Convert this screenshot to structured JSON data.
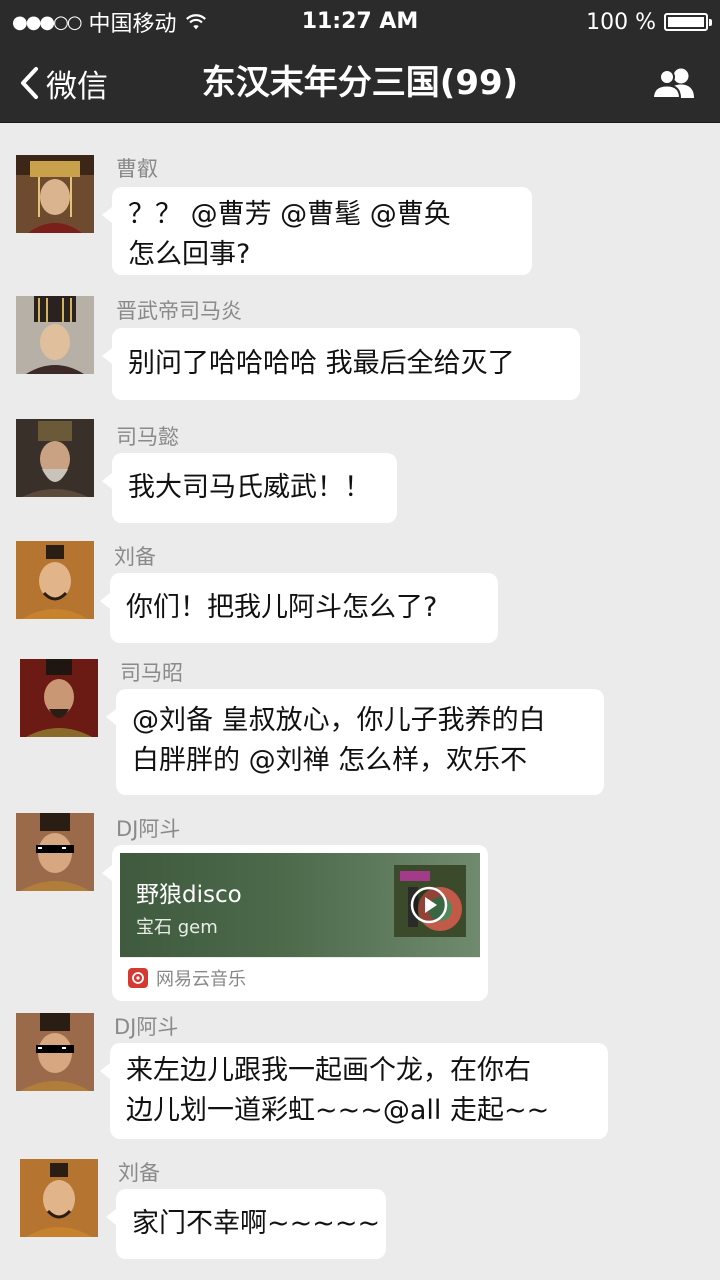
{
  "status_bar": {
    "signal": "●●●○○",
    "carrier": "中国移动",
    "time": "11:27 AM",
    "battery_text": "100 %",
    "battery_level": 1.0
  },
  "nav": {
    "back_label": "微信",
    "title": "东汉末年分三国(99)",
    "members_icon": "group-members-icon"
  },
  "messages": [
    {
      "sender": "曹叡",
      "lines": [
        "？？ @曹芳 @曹髦 @曹奂",
        "怎么回事?"
      ]
    },
    {
      "sender": "晋武帝司马炎",
      "lines": [
        "别问了哈哈哈哈  我最后全给灭了"
      ]
    },
    {
      "sender": "司马懿",
      "lines": [
        "我大司马氏威武！！"
      ]
    },
    {
      "sender": "刘备",
      "lines": [
        "你们！把我儿阿斗怎么了?"
      ]
    },
    {
      "sender": "司马昭",
      "lines": [
        "@刘备 皇叔放心，你儿子我养的白",
        "白胖胖的  @刘禅 怎么样，欢乐不"
      ]
    },
    {
      "sender": "DJ阿斗",
      "card": {
        "title": "野狼disco",
        "artist": "宝石 gem",
        "source": "网易云音乐"
      }
    },
    {
      "sender": "DJ阿斗",
      "lines": [
        "来左边儿跟我一起画个龙，在你右",
        "边儿划一道彩虹~~~@all  走起~~"
      ]
    },
    {
      "sender": "刘备",
      "lines": [
        "家门不幸啊~~~~~"
      ]
    }
  ],
  "colors": {
    "bar_bg": "#2b2b2b",
    "chat_bg": "#ebebeb",
    "bubble_bg": "#ffffff",
    "sender_text": "#8a8a8a",
    "netease_red": "#d33a31"
  }
}
